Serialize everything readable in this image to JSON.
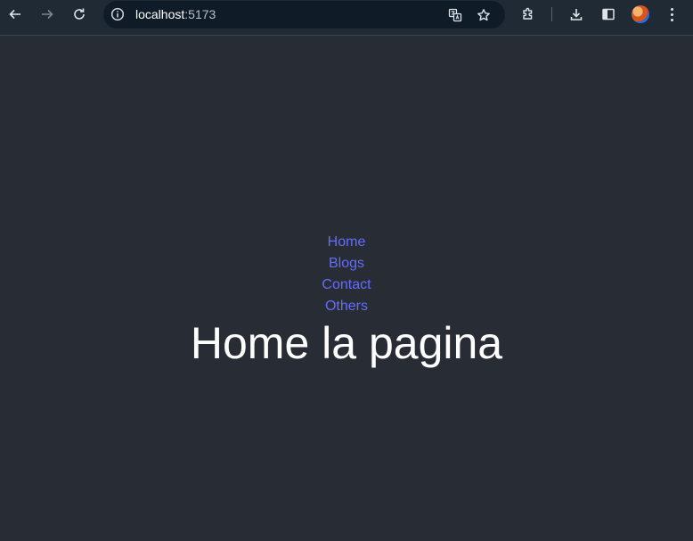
{
  "browser": {
    "url_host": "localhost",
    "url_port": ":5173",
    "icons": {
      "back": "back-arrow-icon",
      "forward": "forward-arrow-icon",
      "reload": "reload-icon",
      "site_info": "info-icon",
      "translate": "translate-icon",
      "bookmark": "star-icon",
      "extensions": "puzzle-icon",
      "downloads": "download-icon",
      "side_panel": "side-panel-icon",
      "menu": "kebab-menu-icon"
    }
  },
  "nav": {
    "links": [
      {
        "label": "Home"
      },
      {
        "label": "Blogs"
      },
      {
        "label": "Contact"
      },
      {
        "label": "Others"
      }
    ]
  },
  "main": {
    "heading": "Home la pagina"
  },
  "colors": {
    "background": "#282c34",
    "link": "#646cff",
    "heading": "#ffffff"
  }
}
